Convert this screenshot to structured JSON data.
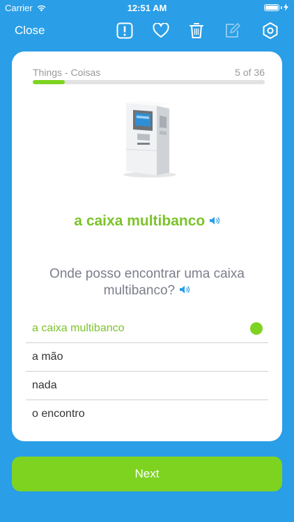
{
  "status_bar": {
    "carrier": "Carrier",
    "time": "12:51 AM"
  },
  "nav": {
    "close_label": "Close",
    "icons": [
      "report-icon",
      "heart-icon",
      "trash-icon",
      "edit-icon",
      "settings-icon"
    ]
  },
  "card": {
    "category": "Things - Coisas",
    "progress_text": "5 of 36",
    "progress_fraction": 0.139,
    "word": "a caixa multibanco",
    "question": "Onde posso encontrar uma caixa multibanco?",
    "answers": [
      {
        "label": "a caixa multibanco",
        "selected": true
      },
      {
        "label": "a mão",
        "selected": false
      },
      {
        "label": "nada",
        "selected": false
      },
      {
        "label": "o encontro",
        "selected": false
      }
    ]
  },
  "next_label": "Next",
  "colors": {
    "background": "#2a9ee6",
    "accent_green": "#7ed321",
    "text_gray": "#7b7e8a"
  }
}
